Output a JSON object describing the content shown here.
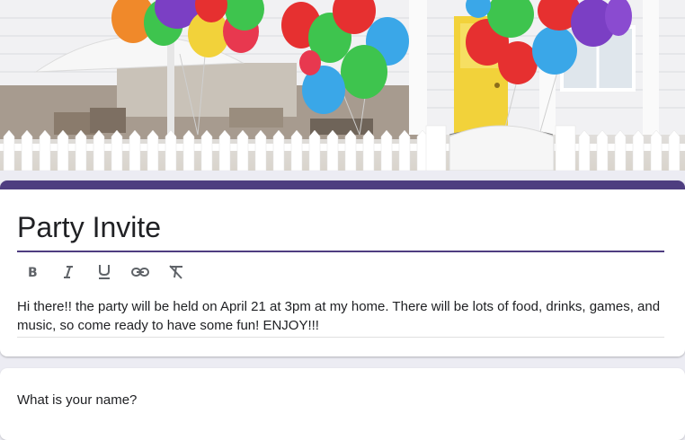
{
  "header_image": {
    "description_icon": "party-balloons-header-image",
    "colors": {
      "fence": "#ffffff",
      "door": "#f2d23a",
      "balloons": [
        "#f0892a",
        "#e63030",
        "#3aa7e8",
        "#3ec44e",
        "#f2d23a",
        "#7b3fc4",
        "#e8384f"
      ]
    }
  },
  "form": {
    "accent_color": "#4e3d80",
    "title": "Party Invite",
    "toolbar": {
      "bold_icon": "bold-icon",
      "italic_icon": "italic-icon",
      "underline_icon": "underline-icon",
      "link_icon": "link-icon",
      "clear_format_icon": "clear-formatting-icon"
    },
    "description": "Hi there!! the party will be held on April 21 at 3pm at my home. There will be lots of food, drinks, games, and music, so come ready to have some fun!  ENJOY!!!"
  },
  "questions": [
    {
      "title": "What is your name?"
    }
  ]
}
